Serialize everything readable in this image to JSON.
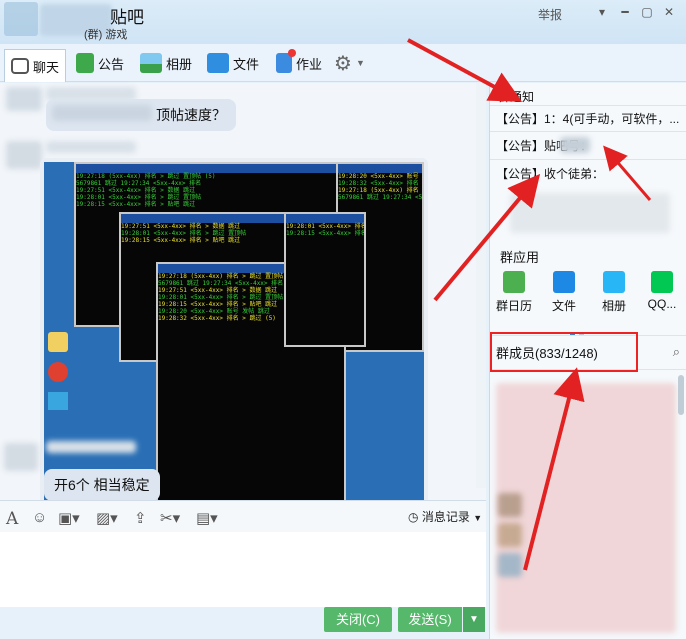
{
  "window": {
    "title": "贴吧",
    "subtitle": "(群) 游戏",
    "report": "举报"
  },
  "toolbar": {
    "chat": "聊天",
    "notice": "公告",
    "album": "相册",
    "files": "文件",
    "homework": "作业"
  },
  "chat": {
    "messages": [
      {
        "text": "顶帖速度？"
      },
      {
        "text": "开6个 相当稳定"
      }
    ],
    "screenshot_lines": [
      "19:27:18 (5xx-4xx) 排名 > 跳过 置顶帖 (5)",
      "5679861 跳过 19:27:34 <5xx-4xx> 排名",
      "19:27:51 <5xx-4xx> 排名 > 数据 跳过",
      "19:28:01 <5xx-4xx> 排名 > 跳过 置顶帖",
      "19:28:15 <5xx-4xx> 排名 > 贴吧 跳过",
      "19:28:20 <5xx-4xx> 账号 发帖 跳过",
      "19:28:32 <5xx-4xx> 排名 > 跳过 (5)"
    ]
  },
  "input": {
    "history": "消息记录",
    "close": "关闭(C)",
    "send": "发送(S)"
  },
  "right_panel": {
    "notice_title": "群通知",
    "notices": [
      "【公告】1：4(可手动，可软件，...",
      "【公告】贴吧号：",
      "【公告】收个徒弟："
    ],
    "apps_title": "群应用",
    "apps": [
      {
        "label": "群日历",
        "color": "#4caf50"
      },
      {
        "label": "文件",
        "color": "#1e88e5"
      },
      {
        "label": "相册",
        "color": "#29b6f6"
      },
      {
        "label": "QQ...",
        "color": "#00c853"
      }
    ],
    "members_label": "群成员(833/1248)"
  },
  "colors": {
    "accent_green": "#55b86b",
    "annotation_red": "#e22222"
  }
}
